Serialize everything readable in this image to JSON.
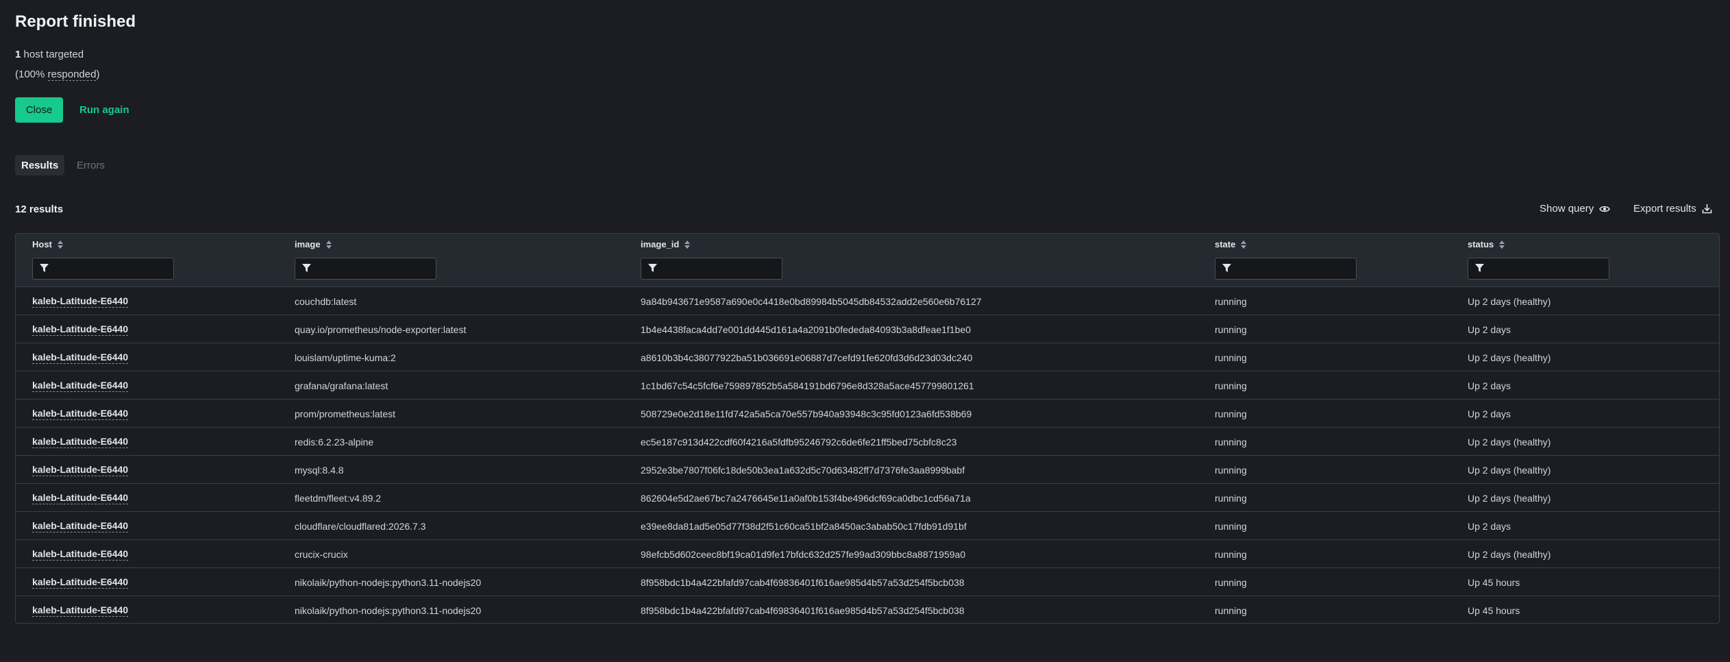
{
  "report": {
    "title": "Report finished",
    "hosts_count": "1",
    "hosts_label": " host targeted",
    "responded_prefix": "(",
    "responded_pct": "100%",
    "responded_word": "responded",
    "responded_suffix": ")"
  },
  "buttons": {
    "close": "Close",
    "run_again": "Run again"
  },
  "tabs": [
    {
      "label": "Results",
      "active": true
    },
    {
      "label": "Errors",
      "active": false
    }
  ],
  "results": {
    "count_label": "12 results",
    "show_query": "Show query",
    "export_results": "Export results"
  },
  "table": {
    "columns": [
      "Host",
      "image",
      "image_id",
      "state",
      "status"
    ],
    "filter_placeholder": "",
    "rows": [
      {
        "host": "kaleb-Latitude-E6440",
        "image": "couchdb:latest",
        "image_id": "9a84b943671e9587a690e0c4418e0bd89984b5045db84532add2e560e6b76127",
        "state": "running",
        "status": "Up 2 days (healthy)"
      },
      {
        "host": "kaleb-Latitude-E6440",
        "image": "quay.io/prometheus/node-exporter:latest",
        "image_id": "1b4e4438faca4dd7e001dd445d161a4a2091b0fededa84093b3a8dfeae1f1be0",
        "state": "running",
        "status": "Up 2 days"
      },
      {
        "host": "kaleb-Latitude-E6440",
        "image": "louislam/uptime-kuma:2",
        "image_id": "a8610b3b4c38077922ba51b036691e06887d7cefd91fe620fd3d6d23d03dc240",
        "state": "running",
        "status": "Up 2 days (healthy)"
      },
      {
        "host": "kaleb-Latitude-E6440",
        "image": "grafana/grafana:latest",
        "image_id": "1c1bd67c54c5fcf6e759897852b5a584191bd6796e8d328a5ace457799801261",
        "state": "running",
        "status": "Up 2 days"
      },
      {
        "host": "kaleb-Latitude-E6440",
        "image": "prom/prometheus:latest",
        "image_id": "508729e0e2d18e11fd742a5a5ca70e557b940a93948c3c95fd0123a6fd538b69",
        "state": "running",
        "status": "Up 2 days"
      },
      {
        "host": "kaleb-Latitude-E6440",
        "image": "redis:6.2.23-alpine",
        "image_id": "ec5e187c913d422cdf60f4216a5fdfb95246792c6de6fe21ff5bed75cbfc8c23",
        "state": "running",
        "status": "Up 2 days (healthy)"
      },
      {
        "host": "kaleb-Latitude-E6440",
        "image": "mysql:8.4.8",
        "image_id": "2952e3be7807f06fc18de50b3ea1a632d5c70d63482ff7d7376fe3aa8999babf",
        "state": "running",
        "status": "Up 2 days (healthy)"
      },
      {
        "host": "kaleb-Latitude-E6440",
        "image": "fleetdm/fleet:v4.89.2",
        "image_id": "862604e5d2ae67bc7a2476645e11a0af0b153f4be496dcf69ca0dbc1cd56a71a",
        "state": "running",
        "status": "Up 2 days (healthy)"
      },
      {
        "host": "kaleb-Latitude-E6440",
        "image": "cloudflare/cloudflared:2026.7.3",
        "image_id": "e39ee8da81ad5e05d77f38d2f51c60ca51bf2a8450ac3abab50c17fdb91d91bf",
        "state": "running",
        "status": "Up 2 days"
      },
      {
        "host": "kaleb-Latitude-E6440",
        "image": "crucix-crucix",
        "image_id": "98efcb5d602ceec8bf19ca01d9fe17bfdc632d257fe99ad309bbc8a8871959a0",
        "state": "running",
        "status": "Up 2 days (healthy)"
      },
      {
        "host": "kaleb-Latitude-E6440",
        "image": "nikolaik/python-nodejs:python3.11-nodejs20",
        "image_id": "8f958bdc1b4a422bfafd97cab4f69836401f616ae985d4b57a53d254f5bcb038",
        "state": "running",
        "status": "Up 45 hours"
      },
      {
        "host": "kaleb-Latitude-E6440",
        "image": "nikolaik/python-nodejs:python3.11-nodejs20",
        "image_id": "8f958bdc1b4a422bfafd97cab4f69836401f616ae985d4b57a53d254f5bcb038",
        "state": "running",
        "status": "Up 45 hours"
      }
    ]
  },
  "icons": {
    "sort": "sort-icon",
    "filter": "filter-icon",
    "eye": "eye-icon",
    "download": "download-icon"
  },
  "colors": {
    "background": "#1b1d22",
    "accent": "#16c98d",
    "table_header": "#252930",
    "border": "#3a3e46"
  }
}
